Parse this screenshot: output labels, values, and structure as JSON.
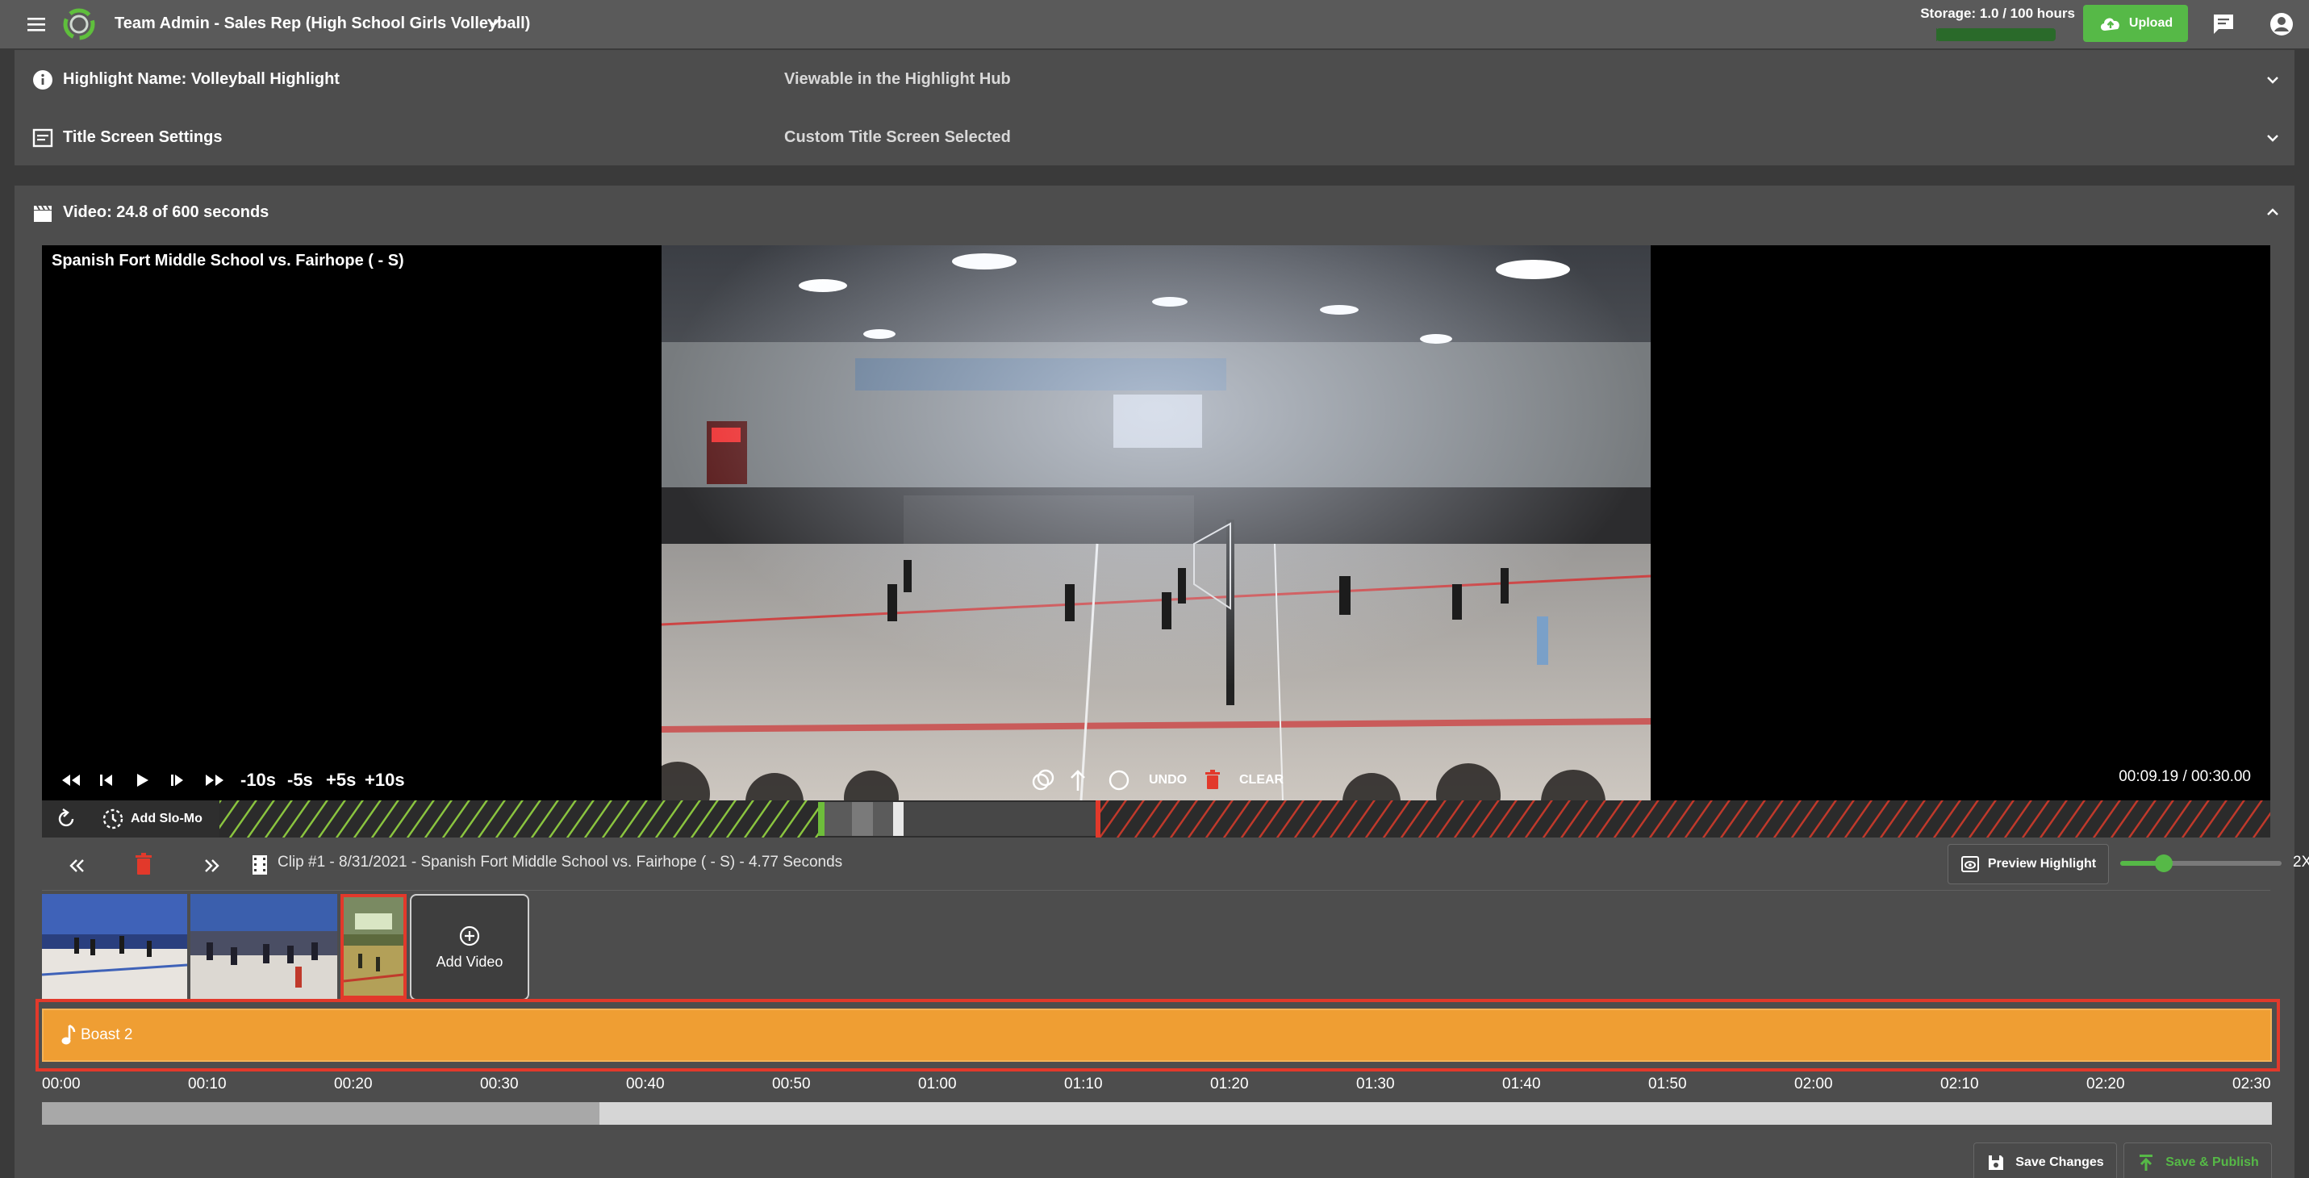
{
  "topbar": {
    "team_title": "Team Admin - Sales Rep (High School Girls Volleyball)",
    "storage_label": "Storage: 1.0 / 100 hours",
    "storage_fraction": 0.01,
    "upload_label": "Upload",
    "icons": [
      "menu-icon",
      "app-logo",
      "chevron-down-icon",
      "cloud-upload-icon",
      "chat-icon",
      "account-icon"
    ]
  },
  "settings": {
    "highlight": {
      "title": "Highlight Name: Volleyball Highlight",
      "value": "Viewable in the Highlight Hub"
    },
    "title_screen": {
      "title": "Title Screen Settings",
      "value": "Custom Title Screen Selected"
    }
  },
  "video": {
    "header": "Video: 24.8 of 600 seconds",
    "game_title": "Spanish Fort Middle School vs. Fairhope ( - S)",
    "jump_labels": [
      "-10s",
      "-5s",
      "+5s",
      "+10s"
    ],
    "undo_label": "UNDO",
    "clear_label": "CLEAR",
    "time": "00:09.19 / 00:30.00",
    "slomo_label": "Add Slo-Mo"
  },
  "clip": {
    "info": "Clip #1 - 8/31/2021 - Spanish Fort Middle School vs. Fairhope ( - S) - 4.77 Seconds",
    "preview_label": "Preview Highlight",
    "zoom_label": "2X",
    "zoom_fraction": 0.27,
    "add_video_label": "Add Video"
  },
  "music": {
    "track_name": "Boast 2"
  },
  "timeline": {
    "ticks": [
      "00:00",
      "00:10",
      "00:20",
      "00:30",
      "00:40",
      "00:50",
      "01:00",
      "01:10",
      "01:20",
      "01:30",
      "01:40",
      "01:50",
      "02:00",
      "02:10",
      "02:20",
      "02:30"
    ],
    "progress_fraction": 0.25
  },
  "actions": {
    "save_label": "Save Changes",
    "publish_label": "Save & Publish"
  },
  "colors": {
    "accent": "#56b947",
    "music": "#ef9e33",
    "danger": "#e2392b"
  }
}
